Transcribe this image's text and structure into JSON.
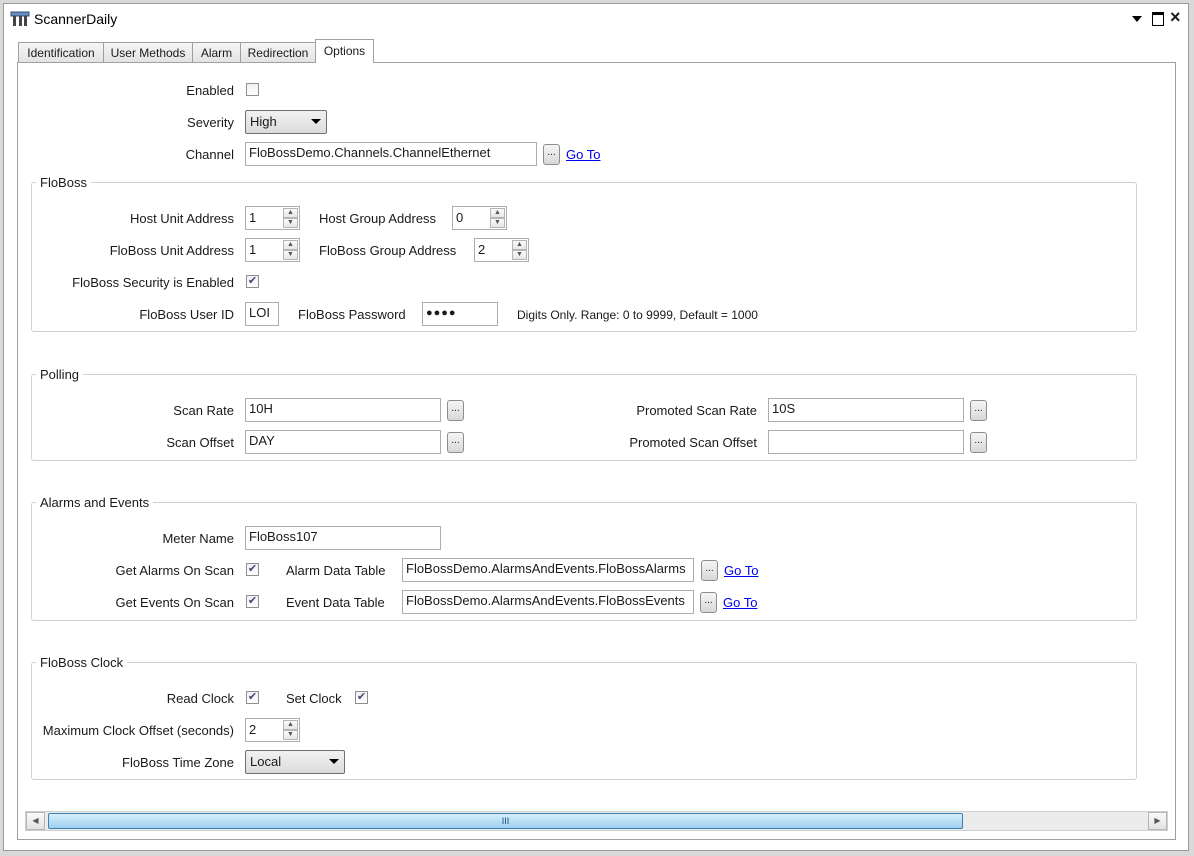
{
  "window": {
    "title": "ScannerDaily",
    "controls": [
      "chevron-down-icon",
      "restore-icon",
      "close-icon"
    ]
  },
  "tabs": [
    {
      "label": "Identification"
    },
    {
      "label": "User Methods"
    },
    {
      "label": "Alarm"
    },
    {
      "label": "Redirection"
    },
    {
      "label": "Options",
      "active": true
    }
  ],
  "general": {
    "enabled_label": "Enabled",
    "enabled": false,
    "severity_label": "Severity",
    "severity_value": "High",
    "channel_label": "Channel",
    "channel_value": "FloBossDemo.Channels.ChannelEthernet",
    "browse": "...",
    "goto": "Go To"
  },
  "floboss": {
    "title": "FloBoss",
    "host_unit_label": "Host Unit Address",
    "host_unit_value": "1",
    "host_group_label": "Host Group Address",
    "host_group_value": "0",
    "floboss_unit_label": "FloBoss Unit Address",
    "floboss_unit_value": "1",
    "floboss_group_label": "FloBoss Group Address",
    "floboss_group_value": "2",
    "security_label": "FloBoss Security is Enabled",
    "security_enabled": true,
    "user_id_label": "FloBoss User ID",
    "user_id_value": "LOI",
    "password_label": "FloBoss Password",
    "password_value": "●●●●",
    "password_hint": "Digits Only. Range: 0 to 9999, Default = 1000"
  },
  "polling": {
    "title": "Polling",
    "scan_rate_label": "Scan Rate",
    "scan_rate_value": "10H",
    "scan_offset_label": "Scan Offset",
    "scan_offset_value": "DAY",
    "promoted_rate_label": "Promoted Scan Rate",
    "promoted_rate_value": "10S",
    "promoted_offset_label": "Promoted Scan Offset",
    "promoted_offset_value": ""
  },
  "alarms": {
    "title": "Alarms and Events",
    "meter_name_label": "Meter Name",
    "meter_name_value": "FloBoss107",
    "get_alarms_label": "Get Alarms On Scan",
    "get_alarms": true,
    "alarm_table_label": "Alarm Data Table",
    "alarm_table_value": "FloBossDemo.AlarmsAndEvents.FloBossAlarms",
    "get_events_label": "Get Events On Scan",
    "get_events": true,
    "event_table_label": "Event Data Table",
    "event_table_value": "FloBossDemo.AlarmsAndEvents.FloBossEvents"
  },
  "clock": {
    "title": "FloBoss Clock",
    "read_clock_label": "Read Clock",
    "read_clock": true,
    "set_clock_label": "Set Clock",
    "set_clock": true,
    "max_offset_label": "Maximum Clock Offset (seconds)",
    "max_offset_value": "2",
    "timezone_label": "FloBoss Time Zone",
    "timezone_value": "Local"
  },
  "scrollbar": {
    "grip": "III"
  },
  "colors": {
    "link": "#0000ee",
    "scroll_thumb": "#9dd1f1",
    "border": "#a0a0a0"
  }
}
